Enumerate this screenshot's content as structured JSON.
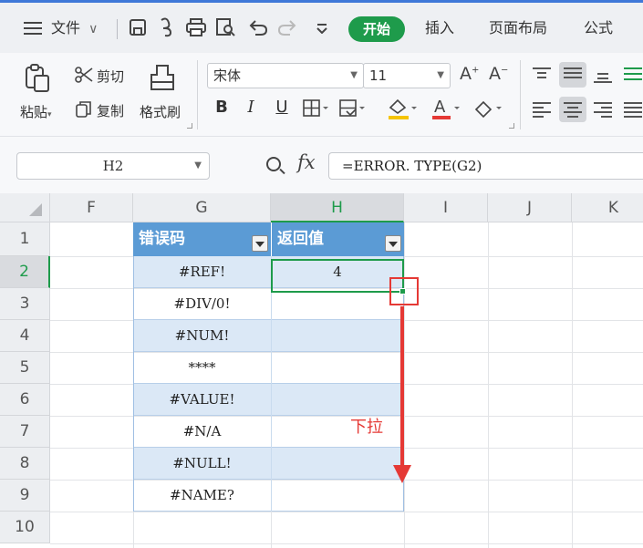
{
  "menu": {
    "file_label": "文件",
    "file_chevron": "∨",
    "quick_icons": [
      "save-icon",
      "cut-format-icon",
      "print-icon",
      "print-preview-icon",
      "undo-icon",
      "redo-icon",
      "customize-icon"
    ],
    "tabs": [
      "开始",
      "插入",
      "页面布局",
      "公式"
    ],
    "active_tab": "开始",
    "accent": "#1e9b4b"
  },
  "ribbon": {
    "paste_label": "粘贴",
    "cut_label": "剪切",
    "copy_label": "复制",
    "format_painter_label": "格式刷",
    "font_name": "宋体",
    "font_size": "11",
    "bold": "B",
    "italic": "I",
    "underline": "U"
  },
  "formula_bar": {
    "cell_ref": "H2",
    "fx_label": "fx",
    "formula": "=ERROR. TYPE(G2)"
  },
  "grid": {
    "columns": [
      "F",
      "G",
      "H",
      "I",
      "J",
      "K"
    ],
    "selected_column": "H",
    "rows": [
      "1",
      "2",
      "3",
      "4",
      "5",
      "6",
      "7",
      "8",
      "9",
      "10"
    ],
    "selected_row": "2",
    "table": {
      "headers": [
        "错误码",
        "返回值"
      ],
      "error_codes": [
        "#REF!",
        "#DIV/0!",
        "#NUM!",
        "****",
        "#VALUE!",
        "#N/A",
        "#NULL!",
        "#NAME?"
      ],
      "return_values": [
        "4",
        "",
        "",
        "",
        "",
        "",
        "",
        ""
      ],
      "band_color": "#dbe8f6",
      "header_color": "#5b9bd5"
    }
  },
  "annotation": {
    "drag_label": "下拉",
    "color": "#e53935"
  }
}
